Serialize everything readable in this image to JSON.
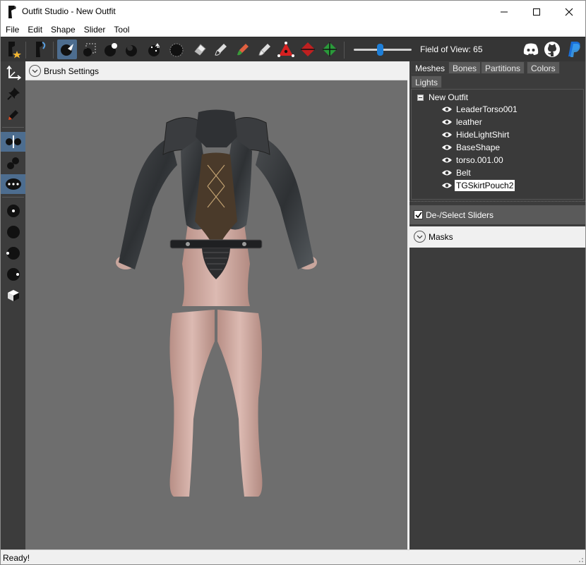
{
  "window": {
    "title": "Outfit Studio - New Outfit"
  },
  "menu": [
    "File",
    "Edit",
    "Shape",
    "Slider",
    "Tool"
  ],
  "toolbar": {
    "fov_label": "Field of View: 65",
    "fov_value": 65,
    "tools": [
      "new-project",
      "load-outfit",
      "select-tool",
      "transform-tool",
      "inflate-brush",
      "deflate-brush",
      "move-brush",
      "smooth-brush",
      "undiff-brush",
      "mask-brush",
      "weight-brush",
      "color-brush",
      "alpha-brush",
      "collapse-vertex",
      "flip-edge",
      "split-edge"
    ],
    "social": [
      "discord-icon",
      "github-icon",
      "paypal-icon"
    ]
  },
  "brush": {
    "label": "Brush Settings"
  },
  "tabs": [
    "Meshes",
    "Bones",
    "Partitions",
    "Colors",
    "Lights"
  ],
  "active_tab": "Meshes",
  "tree": {
    "root": "New Outfit",
    "meshes": [
      "LeaderTorso001",
      "leather",
      "HideLightShirt",
      "BaseShape",
      "torso.001.00",
      "Belt",
      "TGSkirtPouch2"
    ],
    "selected": "TGSkirtPouch2"
  },
  "sliders": {
    "label": "De-/Select Sliders",
    "checked": true
  },
  "masks": {
    "label": "Masks"
  },
  "status": {
    "text": "Ready!"
  }
}
